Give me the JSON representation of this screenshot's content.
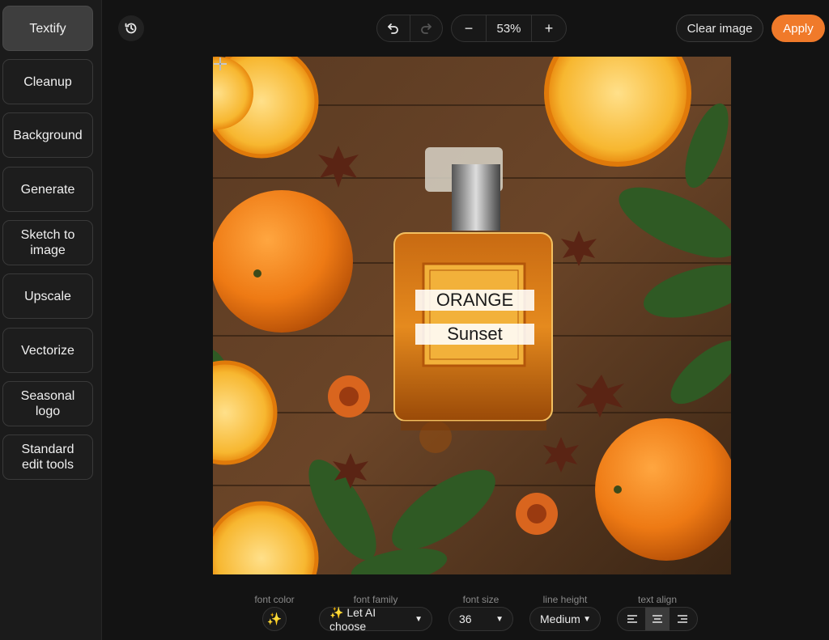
{
  "sidebar": {
    "items": [
      {
        "label": "Textify",
        "active": true
      },
      {
        "label": "Cleanup"
      },
      {
        "label": "Background"
      },
      {
        "label": "Generate"
      },
      {
        "label": "Sketch to\nimage"
      },
      {
        "label": "Upscale"
      },
      {
        "label": "Vectorize"
      },
      {
        "label": "Seasonal\nlogo"
      },
      {
        "label": "Standard\nedit tools"
      }
    ]
  },
  "topbar": {
    "history_icon": "history-icon",
    "undo_icon": "undo-icon",
    "redo_icon": "redo-icon",
    "zoom_out": "−",
    "zoom_value": "53%",
    "zoom_in": "+",
    "clear_label": "Clear image",
    "apply_label": "Apply",
    "accent_color": "#f07a2a"
  },
  "canvas": {
    "text_line_1": "ORANGE",
    "text_line_2": "Sunset"
  },
  "controls": {
    "font_color_label": "font color",
    "font_color_icon": "sparkles-icon",
    "font_family_label": "font family",
    "font_family_value": "✨ Let AI choose",
    "font_size_label": "font size",
    "font_size_value": "36",
    "line_height_label": "line height",
    "line_height_value": "Medium",
    "text_align_label": "text align",
    "text_align_selected": "center"
  }
}
